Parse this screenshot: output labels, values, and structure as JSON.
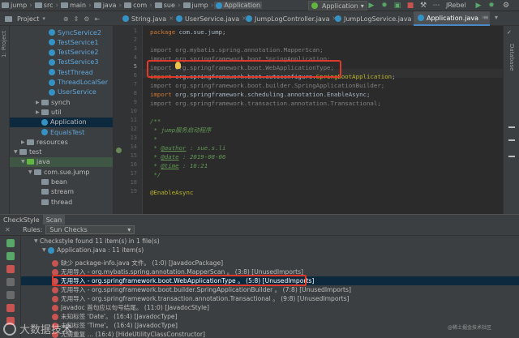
{
  "breadcrumb": [
    "jump",
    "src",
    "main",
    "java",
    "com",
    "sue",
    "jump",
    "Application"
  ],
  "toolbar": {
    "run_config": "Application",
    "jrebel": "JRebel"
  },
  "project_header": {
    "label": "Project"
  },
  "tabs": [
    {
      "label": "String.java",
      "active": false
    },
    {
      "label": "UserService.java",
      "active": false
    },
    {
      "label": "JumpLogController.java",
      "active": false
    },
    {
      "label": "JumpLogService.java",
      "active": false
    },
    {
      "label": "Application.java",
      "active": true
    }
  ],
  "tree": [
    {
      "label": "SyncService2",
      "kind": "class",
      "indent": 5
    },
    {
      "label": "TestService1",
      "kind": "class",
      "indent": 5
    },
    {
      "label": "TestService2",
      "kind": "class",
      "indent": 5
    },
    {
      "label": "TestService3",
      "kind": "class",
      "indent": 5
    },
    {
      "label": "TestThread",
      "kind": "class",
      "indent": 5
    },
    {
      "label": "ThreadLocalSer",
      "kind": "class",
      "indent": 5
    },
    {
      "label": "UserService",
      "kind": "class",
      "indent": 5
    },
    {
      "label": "synch",
      "kind": "folder",
      "indent": 4,
      "arrow": "▶"
    },
    {
      "label": "util",
      "kind": "folder",
      "indent": 4,
      "arrow": "▶"
    },
    {
      "label": "Application",
      "kind": "class",
      "indent": 4,
      "selected": true
    },
    {
      "label": "EqualsTest",
      "kind": "class",
      "indent": 4
    },
    {
      "label": "resources",
      "kind": "folder",
      "indent": 2,
      "arrow": "▶"
    },
    {
      "label": "test",
      "kind": "folder",
      "indent": 1,
      "arrow": "▼"
    },
    {
      "label": "java",
      "kind": "folder-green",
      "indent": 2,
      "arrow": "▼",
      "green": true
    },
    {
      "label": "com.sue.jump",
      "kind": "folder",
      "indent": 3,
      "arrow": "▼"
    },
    {
      "label": "bean",
      "kind": "folder",
      "indent": 4
    },
    {
      "label": "stream",
      "kind": "folder",
      "indent": 4
    },
    {
      "label": "thread",
      "kind": "folder",
      "indent": 4
    }
  ],
  "line_numbers": [
    "1",
    "2",
    "3",
    "4",
    "5",
    "6",
    "7",
    "8",
    "9",
    "10",
    "11",
    "12",
    "13",
    "14",
    "15",
    "16",
    "17",
    "18",
    "19"
  ],
  "code": {
    "l1_kw": "package",
    "l1_rest": " com.sue.jump;",
    "l3": "import org.mybatis.spring.annotation.MapperScan;",
    "l4": "import org.springframework.boot.SpringApplication;",
    "l5": "import org.springframework.boot.WebApplicationType;",
    "l6_kw": "import",
    "l6_rest": " org.springframework.boot.autoconfigure.",
    "l6_cls": "SpringBootApplication",
    "l6_end": ";",
    "l7": "import org.springframework.boot.builder.SpringApplicationBuilder;",
    "l8_kw": "import",
    "l8_rest": " org.springframework.scheduling.annotation.EnableAsync;",
    "l9": "import org.springframework.transaction.annotation.Transactional;",
    "l11": "/**",
    "l12": " * jump服务启动程序",
    "l13": " *",
    "l14_pre": " * ",
    "l14_tag": "@author",
    "l14_val": " : sue.s.li",
    "l15_pre": " * ",
    "l15_tag": "@date",
    "l15_val": " : 2019-08-06",
    "l16_pre": " * ",
    "l16_tag": "@time",
    "l16_val": " : 16:21",
    "l17": " */",
    "l18": "@EnableAsync"
  },
  "checkstyle": {
    "tabs": [
      "CheckStyle",
      "Scan"
    ],
    "rules_label": "Rules:",
    "rules_value": "Sun Checks",
    "summary": "Checkstyle found 11 item(s) in 1 file(s)",
    "file": "Application.java : 11 item(s)",
    "items": [
      "缺少 package-info.java 文件。 (1:0) [JavadocPackage]",
      "无用导入 - org.mybatis.spring.annotation.MapperScan 。 (3:8) [UnusedImports]",
      "无用导入 - org.springframework.boot.WebApplicationType 。 (5:8) [UnusedImports]",
      "无用导入 - org.springframework.boot.builder.SpringApplicationBuilder 。 (7:8) [UnusedImports]",
      "无用导入 - org.springframework.transaction.annotation.Transactional 。 (9:8) [UnusedImports]",
      "Javadoc 首句应以句号结尾。 (11:0) [JavadocStyle]",
      "未知标签 'Date'。 (16:4) [JavadocType]",
      "未知标签 'Time'。 (16:4) [JavadocType]",
      "无需重复 ... (16:4) [HideUtilityClassConstructor]"
    ],
    "selected_index": 2
  },
  "watermark": {
    "text": "大数据技术",
    "small": "@稀土掘金技术社区"
  },
  "colors": {
    "accent": "#4a88c7",
    "highlight": "#e0382b",
    "selection": "#0d293e"
  }
}
